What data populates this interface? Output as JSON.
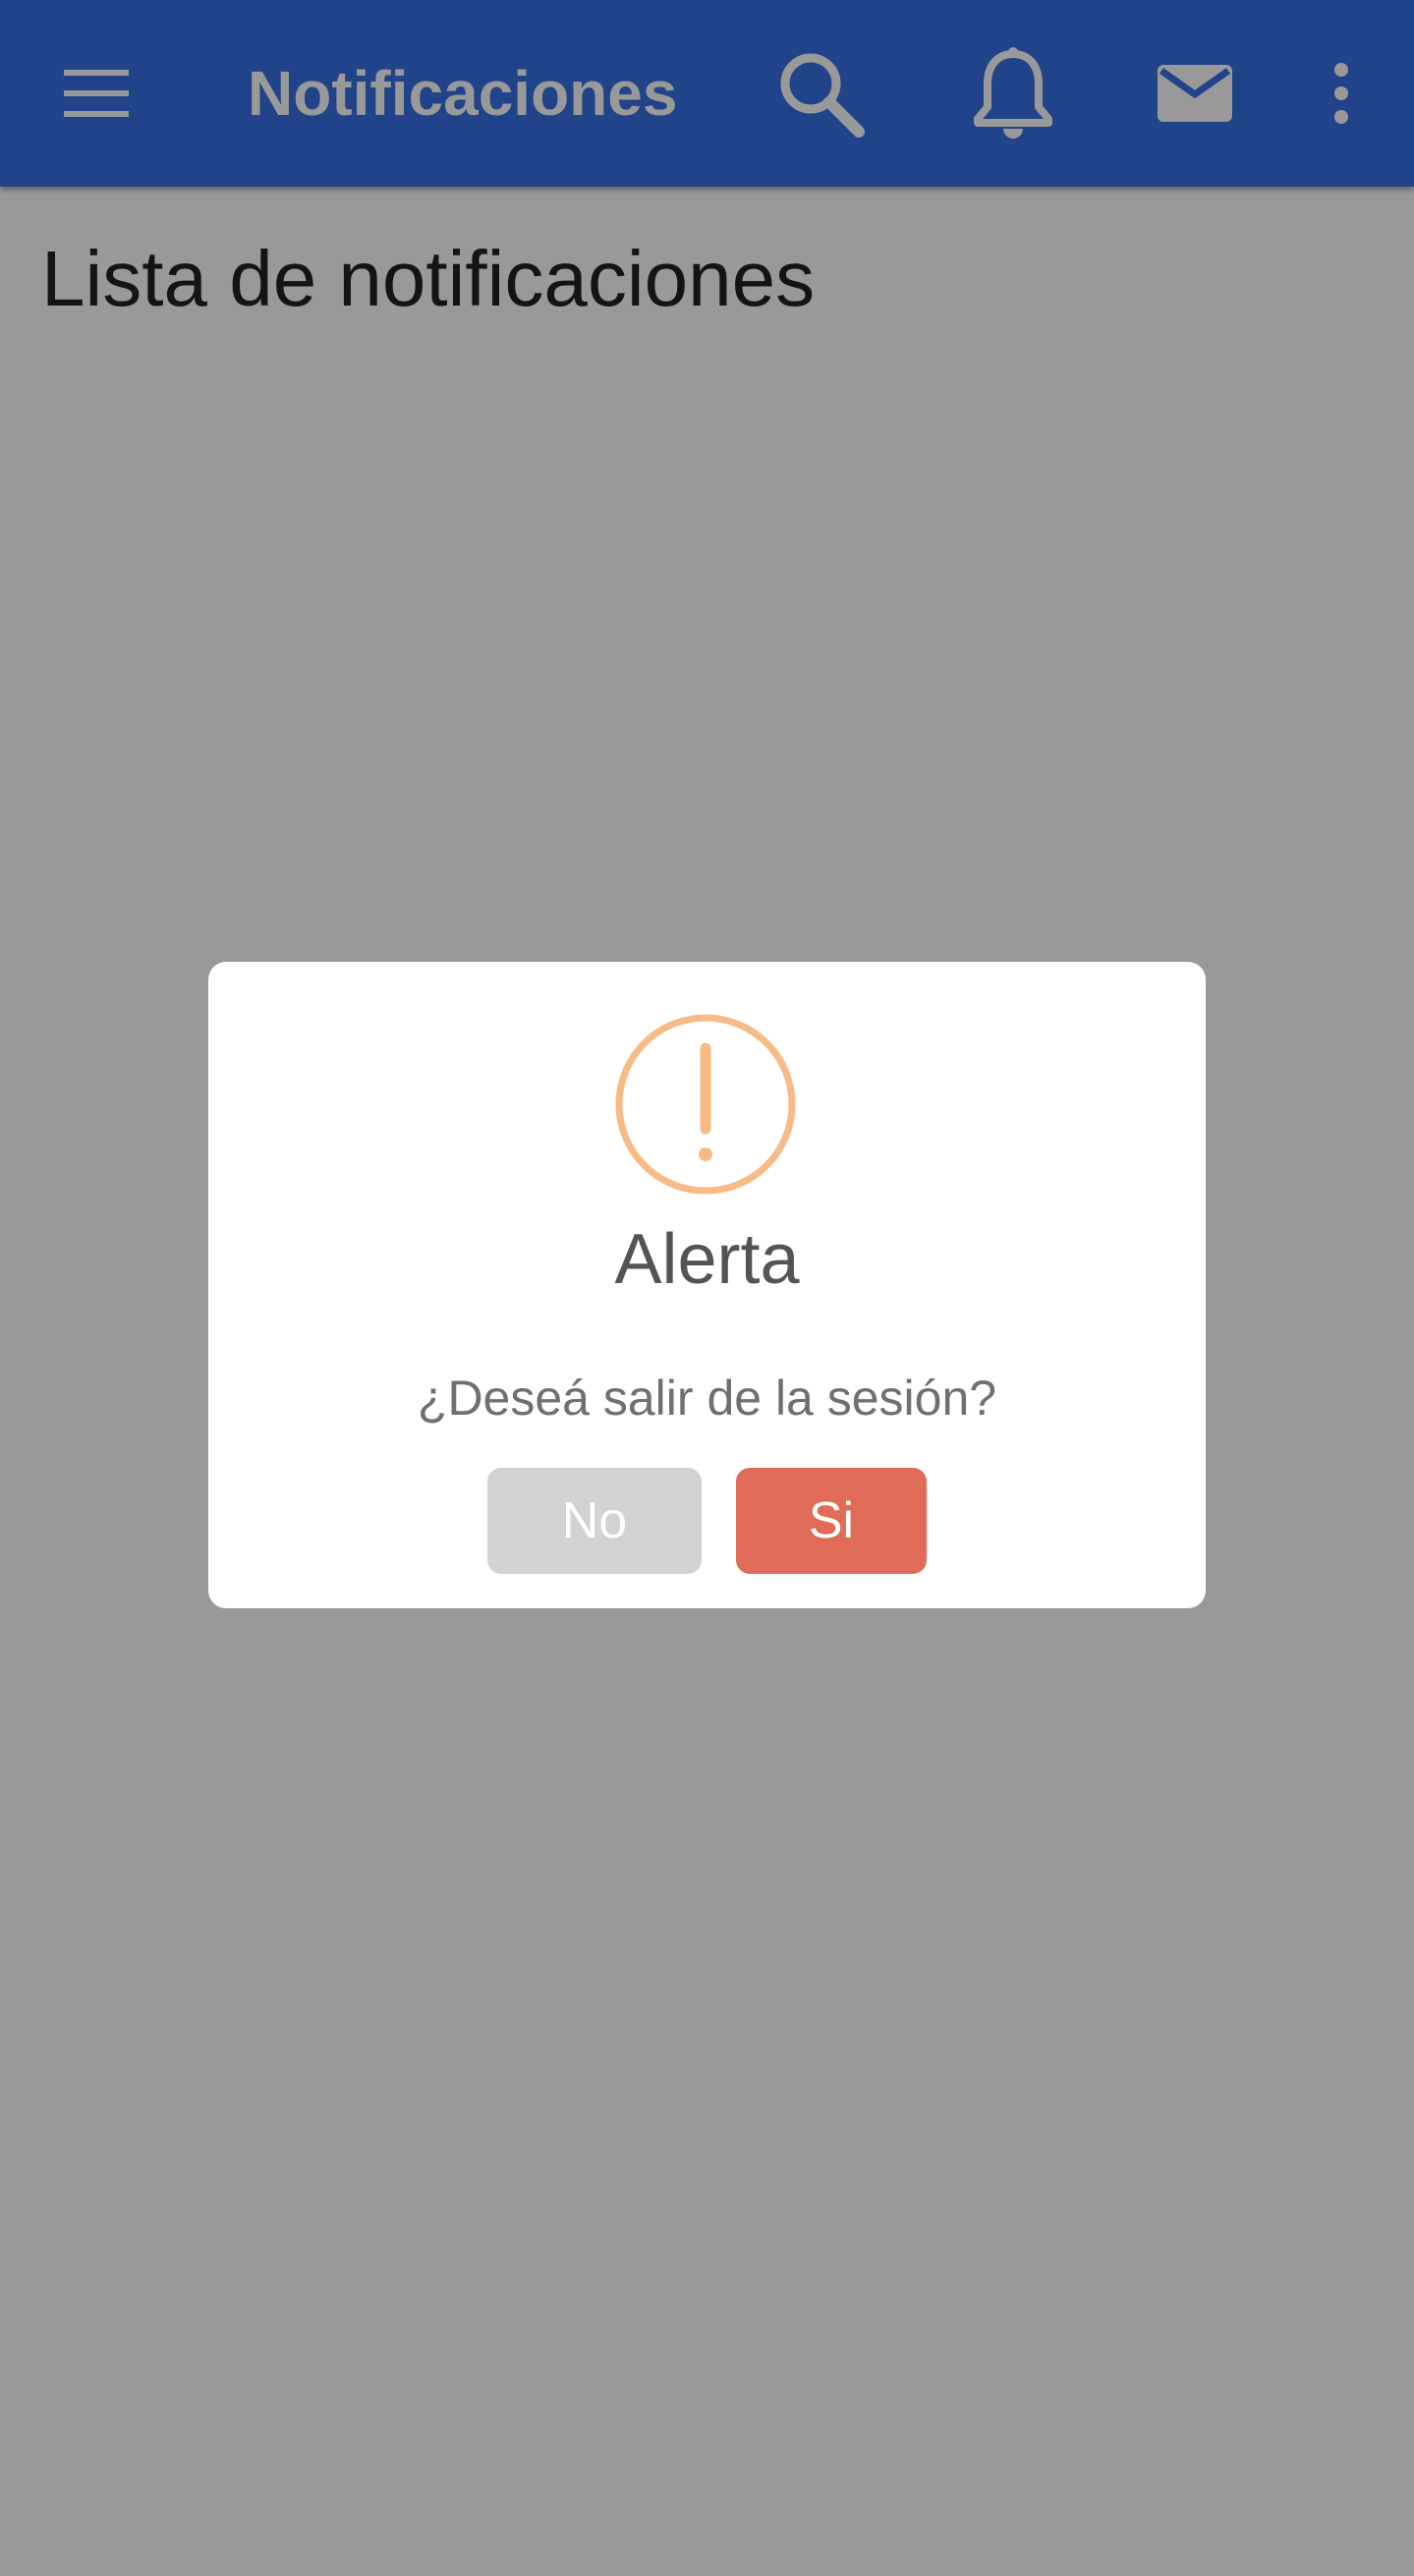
{
  "app_bar": {
    "title": "Notificaciones",
    "icons": [
      "menu-icon",
      "search-icon",
      "bell-icon",
      "mail-icon",
      "more-vert-icon"
    ]
  },
  "page": {
    "heading": "Lista de notificaciones"
  },
  "dialog": {
    "icon": "exclamation-circle-icon",
    "title": "Alerta",
    "message": "¿Deseá salir de la sesión?",
    "no_label": "No",
    "yes_label": "Si"
  },
  "colors": {
    "app_bar": "#3670e6",
    "overlay": "rgba(0,0,0,0.4)",
    "warning_icon": "#f8bb86",
    "button_no": "#d2d2d2",
    "button_yes": "#e06b58"
  }
}
